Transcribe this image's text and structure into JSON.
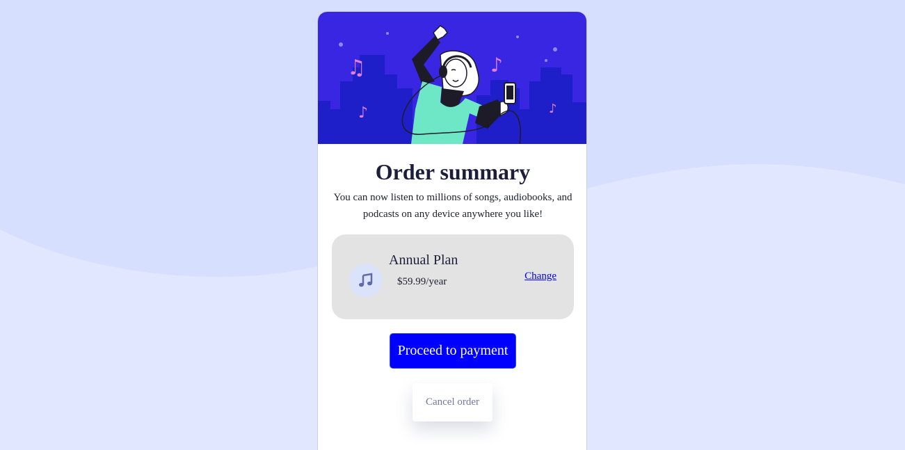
{
  "colors": {
    "page_background": "#d6e0fe",
    "hero_background": "#3826e2",
    "plan_box": "#e3e3e3",
    "primary_button": "#0000ff",
    "link": "#0000ee",
    "cancel_text": "#6f77a8"
  },
  "hero": {
    "illustration": "woman-with-headphones-dancing-music-illustration"
  },
  "summary": {
    "title": "Order summary",
    "description": "You can now listen to millions of songs, audiobooks, and podcasts on any device anywhere you like!"
  },
  "plan": {
    "icon": "music-note-icon",
    "name": "Annual Plan",
    "price": "$59.99/year",
    "change_label": "Change"
  },
  "actions": {
    "proceed_label": "Proceed to payment",
    "cancel_label": "Cancel order"
  }
}
